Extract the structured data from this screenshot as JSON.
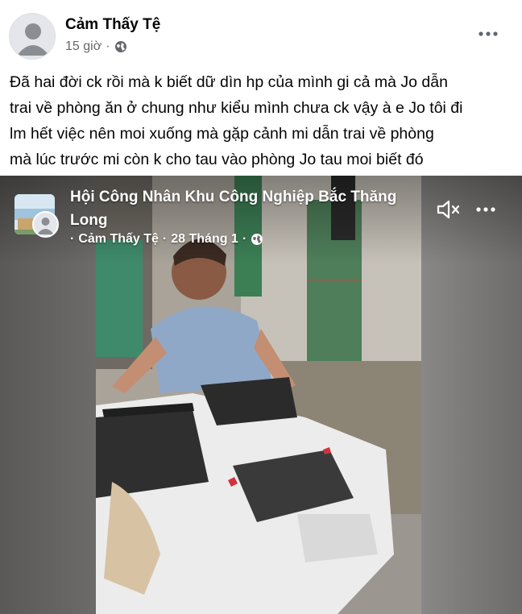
{
  "post": {
    "author": "Cảm Thấy Tệ",
    "time": "15 giờ",
    "separator": "·",
    "privacy_icon": "globe-icon",
    "more_icon": "more-dots-icon",
    "text_lines": [
      "Đã hai đời ck rồi mà k biết dữ dìn hp của mình gi cả mà Jo dẫn",
      "trai về phòng ăn ở chung như kiểu mình chưa ck vậy à e Jo tôi đi",
      "lm hết việc nên moi xuống mà gặp cảnh mi dẫn trai về phòng",
      "mà lúc trước mi còn k cho tau vào phòng Jo tau moi biết đó"
    ]
  },
  "shared": {
    "group_line1": "Hội Công Nhân Khu Công Nghiệp Bắc Thăng",
    "group_line2": "Long",
    "meta_prefix": "·",
    "sub_author": "Cảm Thấy Tệ",
    "separator": "·",
    "date": "28 Tháng 1",
    "mute_icon": "speaker-muted-icon",
    "more_icon": "more-dots-icon",
    "video_description": "woman in blue shirt on white motorcycle"
  },
  "colors": {
    "name": "#050505",
    "meta": "#65676b",
    "overlay_text": "#ffffff",
    "video_bg": "#5a5857"
  }
}
